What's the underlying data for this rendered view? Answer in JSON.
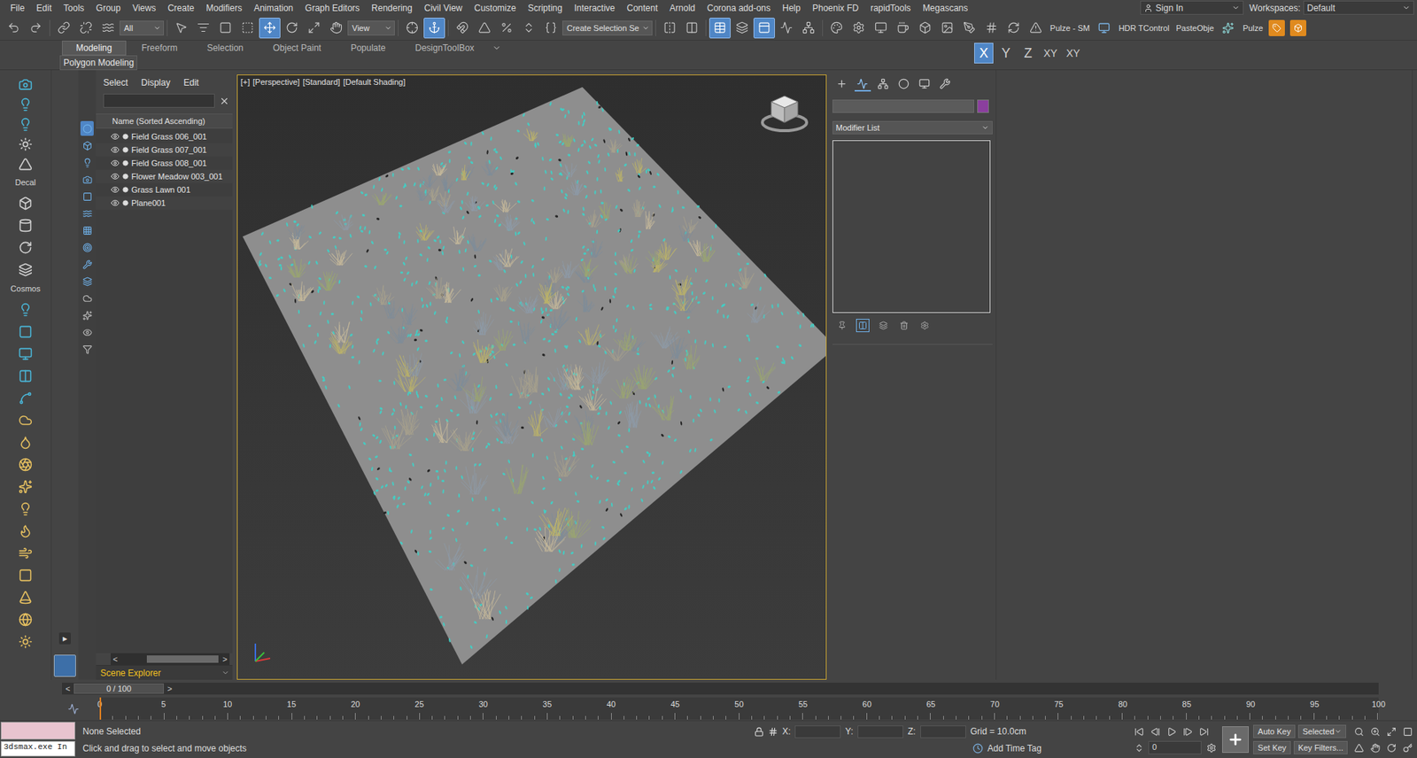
{
  "menu": [
    "File",
    "Edit",
    "Tools",
    "Group",
    "Views",
    "Create",
    "Modifiers",
    "Animation",
    "Graph Editors",
    "Rendering",
    "Civil View",
    "Customize",
    "Scripting",
    "Interactive",
    "Content",
    "Arnold",
    "Corona add-ons",
    "Help",
    "Phoenix FD",
    "rapidTools",
    "Megascans"
  ],
  "account": {
    "label": "Sign In"
  },
  "workspaces": {
    "label": "Workspaces:",
    "value": "Default"
  },
  "toolbar": {
    "selection_filter": "All",
    "ref_coord": "View",
    "named_selection": "Create Selection Se",
    "plugins": [
      "Pulze - SM",
      "HDR TControl",
      "PasteObje",
      "Pulze"
    ],
    "buttons": [
      {
        "selected": false
      },
      {
        "selected": false
      },
      {
        "selected": false
      },
      {
        "selected": false
      },
      {
        "selected": false
      },
      {
        "selected": false
      },
      {
        "selected": false
      },
      {
        "selected": false
      },
      {
        "selected": false
      },
      {
        "selected": true
      },
      {
        "selected": false
      },
      {
        "selected": false
      },
      {
        "selected": false
      },
      {
        "selected": false
      },
      {
        "selected": true
      },
      {
        "selected": false
      },
      {
        "selected": false
      },
      {
        "selected": false
      },
      {
        "selected": false
      },
      {
        "selected": false
      },
      {
        "selected": false
      },
      {
        "selected": false
      },
      {
        "selected": true
      },
      {
        "selected": false
      },
      {
        "selected": true
      },
      {
        "selected": false
      },
      {
        "selected": false
      },
      {
        "selected": false
      },
      {
        "selected": false
      },
      {
        "selected": false
      },
      {
        "selected": false
      },
      {
        "selected": false
      },
      {
        "selected": false
      },
      {
        "selected": false
      },
      {
        "selected": false
      },
      {
        "selected": false
      },
      {
        "selected": false
      }
    ]
  },
  "ribbon": {
    "tabs": [
      {
        "label": "Modeling",
        "selected": true
      },
      {
        "label": "Freeform",
        "selected": false
      },
      {
        "label": "Selection",
        "selected": false
      },
      {
        "label": "Object Paint",
        "selected": false
      },
      {
        "label": "Populate",
        "selected": false
      },
      {
        "label": "DesignToolBox",
        "selected": false
      }
    ],
    "panel": "Polygon Modeling"
  },
  "axis_constraints": [
    {
      "label": "X",
      "selected": true
    },
    {
      "label": "Y",
      "selected": false
    },
    {
      "label": "Z",
      "selected": false
    },
    {
      "label": "XY",
      "selected": false
    },
    {
      "label": "XY",
      "selected": false
    }
  ],
  "left_bar": {
    "labels": [
      "Decal",
      "Cosmos"
    ]
  },
  "scene_explorer": {
    "menu": [
      "Select",
      "Display",
      "Edit"
    ],
    "search": "",
    "column": "Name (Sorted Ascending)",
    "rows": [
      {
        "name": "Field Grass 006_001",
        "visible": true
      },
      {
        "name": "Field Grass 007_001",
        "visible": true
      },
      {
        "name": "Field Grass 008_001",
        "visible": true
      },
      {
        "name": "Flower Meadow 003_001",
        "visible": true
      },
      {
        "name": "Grass Lawn 001",
        "visible": true
      },
      {
        "name": "Plane001",
        "visible": true
      }
    ],
    "scroll_left": "<",
    "scroll_right": ">",
    "expand": "▶",
    "footer": "Scene Explorer"
  },
  "viewport": {
    "labels": [
      "[+]",
      "[Perspective]",
      "[Standard]",
      "[Default Shading]"
    ],
    "active": true
  },
  "command_panel": {
    "tabs": [
      {
        "selected": false
      },
      {
        "selected": true
      },
      {
        "selected": false
      },
      {
        "selected": false
      },
      {
        "selected": false
      },
      {
        "selected": false
      }
    ],
    "name": "",
    "modifier_list": "Modifier List"
  },
  "timeline": {
    "position": "0 / 100",
    "prev": "<",
    "next": ">",
    "level": 0,
    "ticks": [
      "0",
      "5",
      "10",
      "15",
      "20",
      "25",
      "30",
      "35",
      "40",
      "45",
      "50",
      "55",
      "60",
      "65",
      "70",
      "75",
      "80",
      "85",
      "90",
      "95",
      "100"
    ]
  },
  "status": {
    "listener": "3dsmax.exe In",
    "selection": "None Selected",
    "prompt": "Click and drag to select and move objects",
    "x_label": "X:",
    "y_label": "Y:",
    "z_label": "Z:",
    "grid": "Grid = 10.0cm",
    "time_tag": "Add Time Tag",
    "auto_key": "Auto Key",
    "key_mode": "Selected",
    "set_key": "Set Key",
    "key_filters": "Key Filters...",
    "frame": "0"
  }
}
